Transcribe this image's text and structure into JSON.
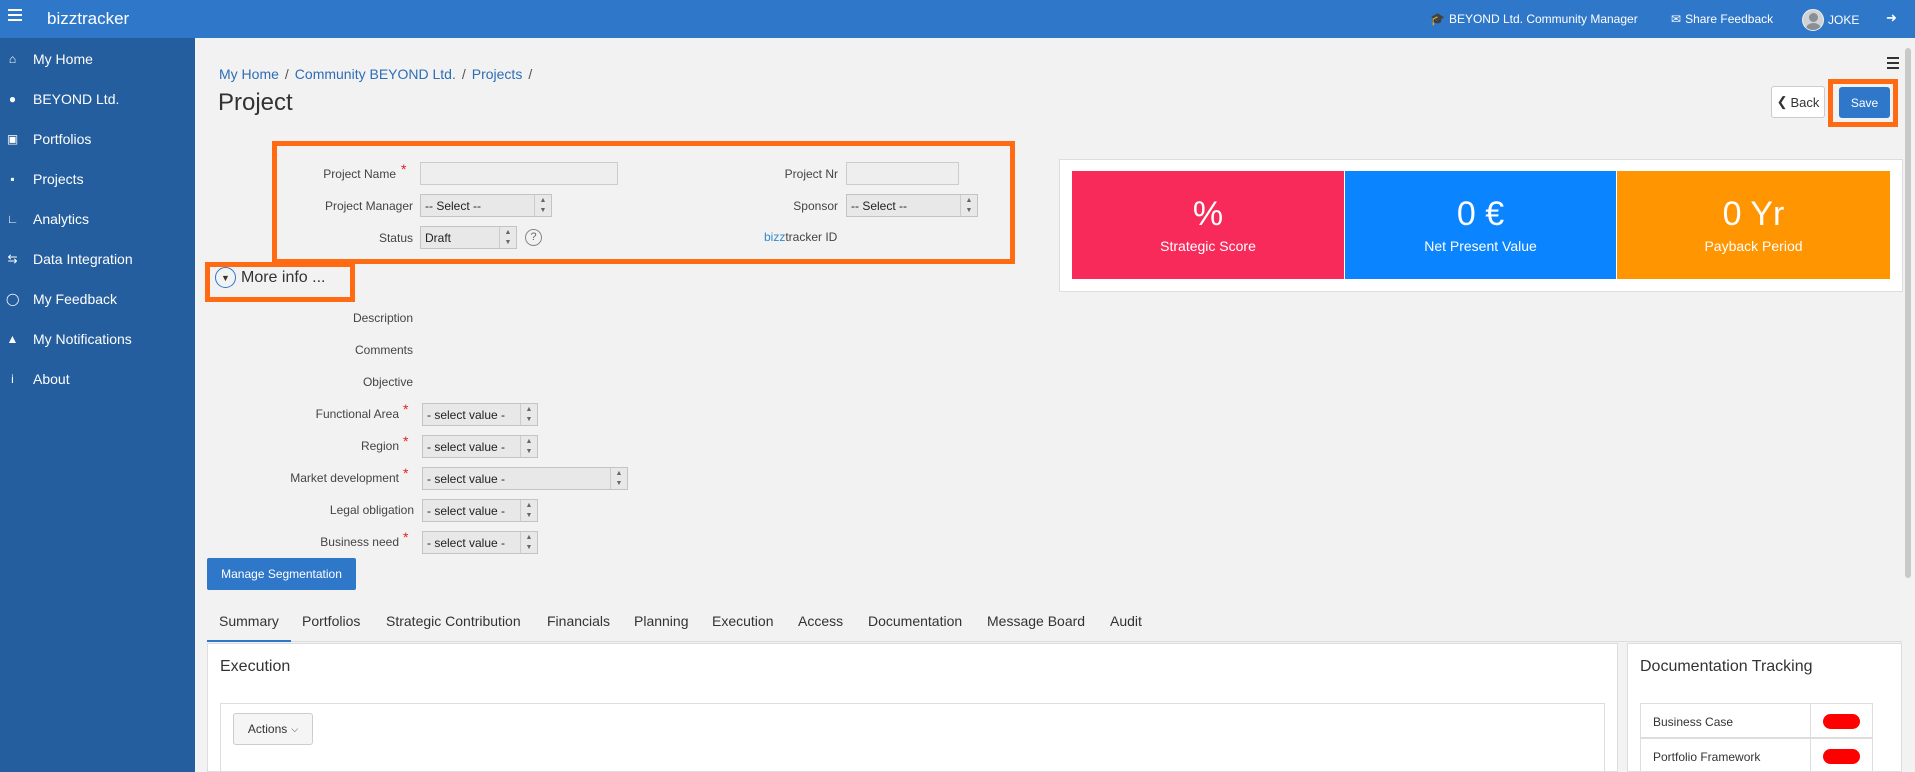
{
  "app": {
    "brand": "bizztracker"
  },
  "topbar": {
    "community": "BEYOND Ltd. Community Manager",
    "feedback": "Share Feedback",
    "user": "JOKE"
  },
  "sidebar": {
    "items": [
      {
        "label": "My Home",
        "icon": "home-icon"
      },
      {
        "label": "BEYOND Ltd.",
        "icon": "users-icon"
      },
      {
        "label": "Portfolios",
        "icon": "briefcase-icon"
      },
      {
        "label": "Projects",
        "icon": "bar-chart-icon"
      },
      {
        "label": "Analytics",
        "icon": "line-chart-icon"
      },
      {
        "label": "Data Integration",
        "icon": "exchange-icon"
      },
      {
        "label": "My Feedback",
        "icon": "comments-icon"
      },
      {
        "label": "My Notifications",
        "icon": "bell-icon"
      },
      {
        "label": "About",
        "icon": "info-icon"
      }
    ]
  },
  "breadcrumb": [
    "My Home",
    "Community BEYOND Ltd.",
    "Projects"
  ],
  "page": {
    "title": "Project",
    "back": "Back",
    "save": "Save"
  },
  "form": {
    "project_name": {
      "label": "Project Name",
      "value": ""
    },
    "project_nr": {
      "label": "Project Nr",
      "value": ""
    },
    "project_manager": {
      "label": "Project Manager",
      "value": "-- Select --"
    },
    "sponsor": {
      "label": "Sponsor",
      "value": "-- Select --"
    },
    "status": {
      "label": "Status",
      "value": "Draft"
    },
    "bizz_id": {
      "prefix": "bizz",
      "suffix": "tracker ID"
    }
  },
  "more_info": {
    "toggle": "More info ...",
    "description": "Description",
    "comments": "Comments",
    "objective": "Objective",
    "functional_area": {
      "label": "Functional Area",
      "value": "- select value -"
    },
    "region": {
      "label": "Region",
      "value": "- select value -"
    },
    "market_development": {
      "label": "Market development",
      "value": "- select value -"
    },
    "legal_obligation": {
      "label": "Legal obligation",
      "value": "- select value -"
    },
    "business_need": {
      "label": "Business need",
      "value": "- select value -"
    },
    "manage_segmentation": "Manage Segmentation"
  },
  "kpis": [
    {
      "value": "%",
      "label": "Strategic Score",
      "color": "#f72a5a"
    },
    {
      "value": "0 €",
      "label": "Net Present Value",
      "color": "#0a84ff"
    },
    {
      "value": "0 Yr",
      "label": "Payback Period",
      "color": "#ff9500"
    }
  ],
  "tabs": [
    "Summary",
    "Portfolios",
    "Strategic Contribution",
    "Financials",
    "Planning",
    "Execution",
    "Access",
    "Documentation",
    "Message Board",
    "Audit"
  ],
  "execution_panel": {
    "title": "Execution",
    "actions": "Actions"
  },
  "doc_panel": {
    "title": "Documentation Tracking",
    "rows": [
      {
        "name": "Business Case",
        "status_color": "#ff0000"
      },
      {
        "name": "Portfolio Framework",
        "status_color": "#ff0000"
      }
    ]
  }
}
